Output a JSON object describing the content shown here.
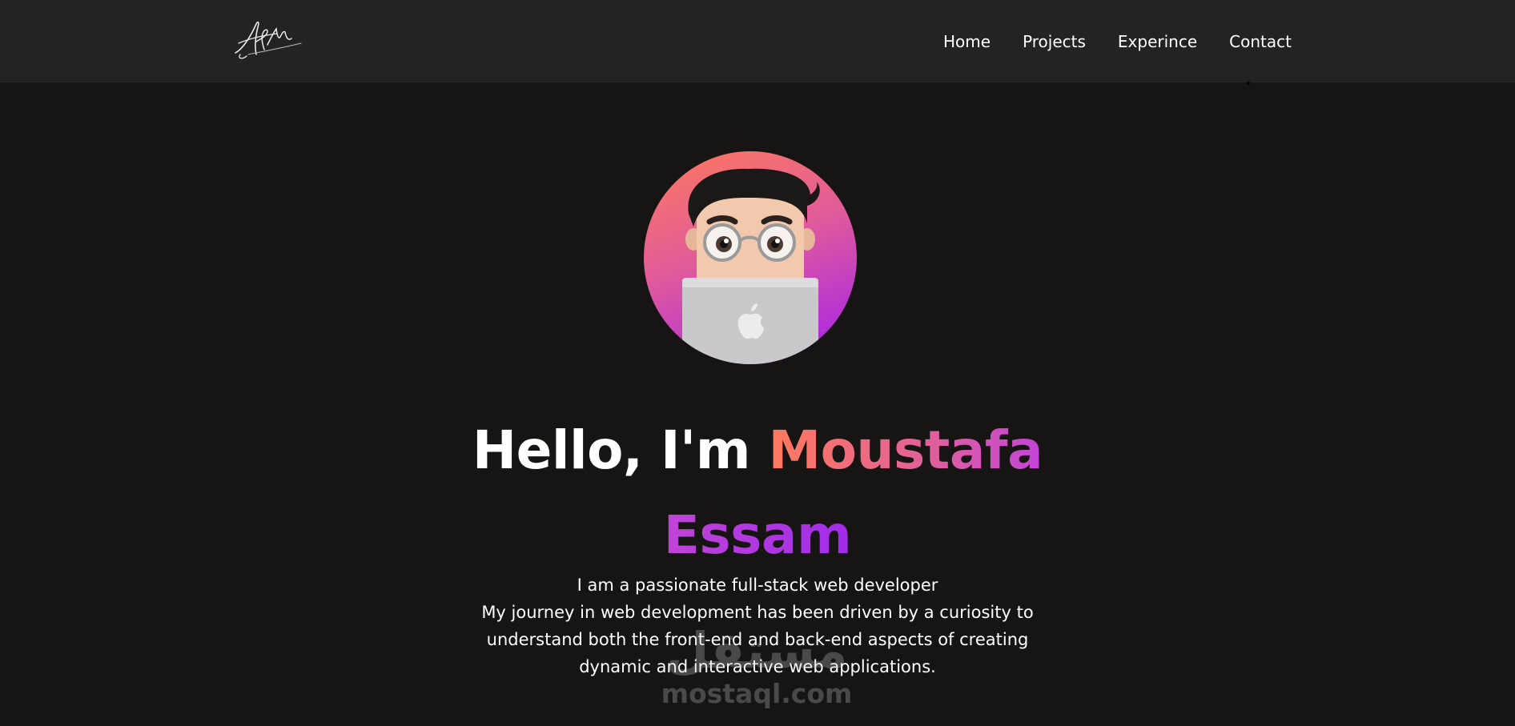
{
  "logo": {
    "text": "AbM"
  },
  "nav": {
    "items": [
      {
        "label": "Home"
      },
      {
        "label": "Projects"
      },
      {
        "label": "Experince"
      },
      {
        "label": "Contact"
      }
    ]
  },
  "hero": {
    "greeting": "Hello, I'm ",
    "name": "Moustafa Essam",
    "intro_lines": [
      "I am a passionate full-stack web developer",
      "My journey in web development has been driven by a curiosity to",
      "understand both the front-end and back-end aspects of creating",
      "dynamic and interactive web applications."
    ],
    "avatar": {
      "icon": "memoji-laptop-avatar",
      "gradient": [
        "#ff7a5c",
        "#e05b9a",
        "#a21ff0"
      ]
    }
  },
  "watermark": {
    "arabic": "مستقل",
    "latin": "mostaql.com"
  },
  "colors": {
    "page_background": "#161514",
    "navbar_background": "#232323",
    "name_gradient": [
      "#ff7a5c",
      "#a02ce8"
    ]
  }
}
